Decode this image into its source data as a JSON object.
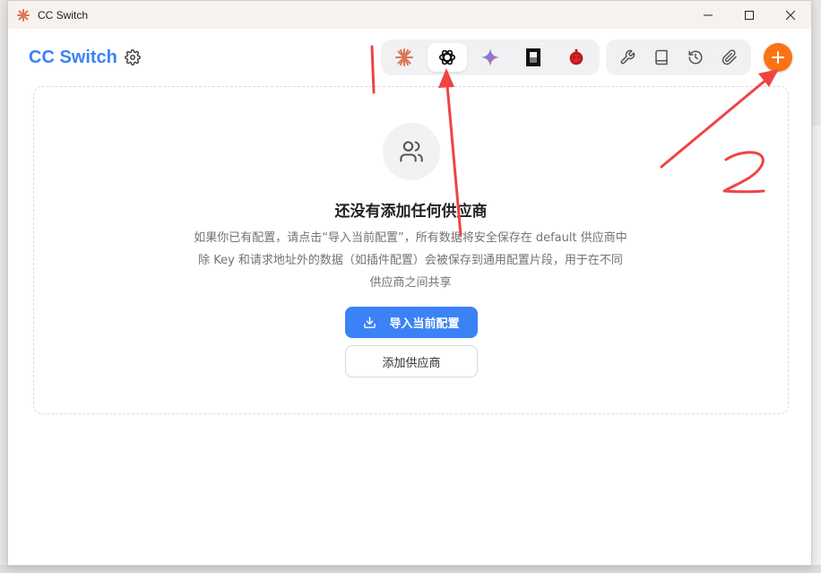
{
  "window": {
    "title": "CC Switch"
  },
  "header": {
    "brand": "CC Switch"
  },
  "app_switcher": {
    "apps": [
      {
        "name": "claude",
        "icon": "claude-icon"
      },
      {
        "name": "codex",
        "icon": "openai-icon",
        "active": true
      },
      {
        "name": "gemini",
        "icon": "gemini-icon"
      },
      {
        "name": "opencode",
        "icon": "opencode-icon"
      },
      {
        "name": "droid",
        "icon": "droid-icon"
      }
    ]
  },
  "tools": [
    {
      "icon": "wrench-icon"
    },
    {
      "icon": "book-icon"
    },
    {
      "icon": "history-icon"
    },
    {
      "icon": "paperclip-icon"
    }
  ],
  "empty_state": {
    "title": "还没有添加任何供应商",
    "desc_line1": "如果你已有配置，请点击“导入当前配置”，所有数据将安全保存在 default 供应商中",
    "desc_line2": "除 Key 和请求地址外的数据（如插件配置）会被保存到通用配置片段，用于在不同",
    "desc_line3": "供应商之间共享",
    "import_label": "导入当前配置",
    "add_label": "添加供应商"
  },
  "colors": {
    "brand": "#3b82f6",
    "accent_orange": "#f97316",
    "annotation": "#ef4444"
  },
  "annotations": {
    "mark1": "1",
    "mark2": "2"
  }
}
